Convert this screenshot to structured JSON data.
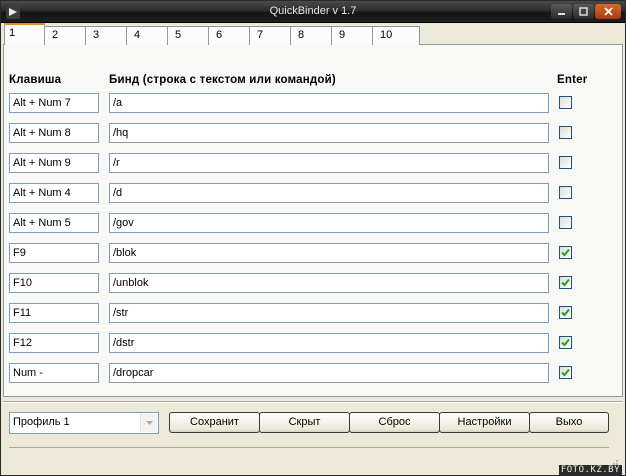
{
  "window": {
    "title": "QuickBinder v 1.7"
  },
  "tabs": [
    "1",
    "2",
    "3",
    "4",
    "5",
    "6",
    "7",
    "8",
    "9",
    "10"
  ],
  "active_tab": 0,
  "headers": {
    "key": "Клавиша",
    "bind": "Бинд (строка с текстом или командой)",
    "enter": "Enter"
  },
  "rows": [
    {
      "key": "Alt + Num 7",
      "bind": "/a",
      "enter": false
    },
    {
      "key": "Alt + Num 8",
      "bind": "/hq",
      "enter": false
    },
    {
      "key": "Alt + Num 9",
      "bind": "/r",
      "enter": false
    },
    {
      "key": "Alt + Num 4",
      "bind": "/d",
      "enter": false
    },
    {
      "key": "Alt + Num 5",
      "bind": "/gov",
      "enter": false
    },
    {
      "key": "F9",
      "bind": "/blok",
      "enter": true
    },
    {
      "key": "F10",
      "bind": "/unblok",
      "enter": true
    },
    {
      "key": "F11",
      "bind": "/str",
      "enter": true
    },
    {
      "key": "F12",
      "bind": "/dstr",
      "enter": true
    },
    {
      "key": "Num -",
      "bind": "/dropcar",
      "enter": true
    }
  ],
  "profile": {
    "selected": "Профиль 1"
  },
  "buttons": {
    "save": "Сохранит",
    "hide": "Скрыт",
    "reset": "Сброс",
    "settings": "Настройки",
    "exit": "Выхо"
  },
  "watermark": "FOTO.KZ.BY",
  "colors": {
    "active_tab_accent": "#e68b2c",
    "field_border": "#7f9db9",
    "checkbox_border": "#1c5180",
    "checkmark": "#21a121"
  }
}
